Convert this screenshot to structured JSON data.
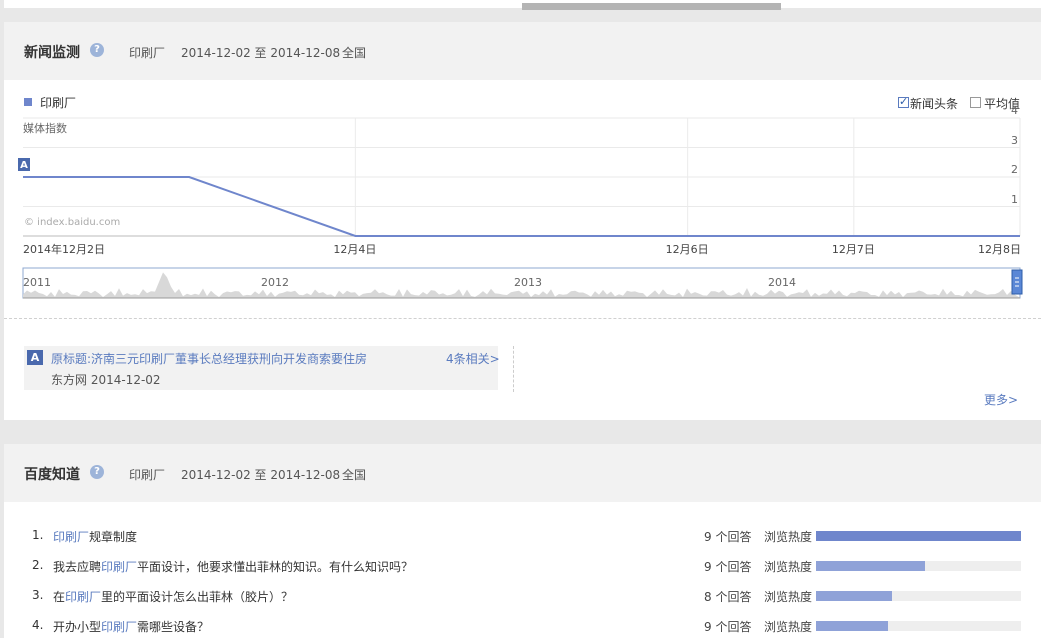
{
  "news_panel": {
    "title": "新闻监测",
    "keyword": "印刷厂",
    "date_range": "2014-12-02 至 2014-12-08",
    "region": "全国",
    "legend_label": "印刷厂",
    "checkbox_headlines": "新闻头条",
    "checkbox_headlines_checked": true,
    "checkbox_average": "平均值",
    "checkbox_average_checked": false,
    "watermark": "© index.baidu.com",
    "marker_label": "A",
    "overview_years": [
      "2011",
      "2012",
      "2013",
      "2014"
    ],
    "news_item": {
      "marker": "A",
      "title": "原标题:济南三元印刷厂董事长总经理获刑向开发商索要住房",
      "source": "东方网 2014-12-02",
      "related": "4条相关>"
    },
    "more_link": "更多>"
  },
  "chart_data": {
    "type": "line",
    "ylabel": "媒体指数",
    "y_ticks": [
      "1",
      "2",
      "3",
      "4"
    ],
    "ylim": [
      0,
      4
    ],
    "x_tick_labels": [
      "2014年12月2日",
      "12月4日",
      "12月6日",
      "12月7日",
      "12月8日"
    ],
    "x_tick_dates": [
      "2014-12-02",
      "2014-12-04",
      "2014-12-06",
      "2014-12-07",
      "2014-12-08"
    ],
    "xlim": [
      "2014-12-02",
      "2014-12-08"
    ],
    "grid": true,
    "series": [
      {
        "name": "印刷厂",
        "color": "#6f86cc",
        "x": [
          "2014-12-02",
          "2014-12-03",
          "2014-12-04",
          "2014-12-05",
          "2014-12-06",
          "2014-12-07",
          "2014-12-08"
        ],
        "values": [
          2,
          2,
          0,
          0,
          0,
          0,
          0
        ]
      }
    ]
  },
  "zhidao_panel": {
    "title": "百度知道",
    "keyword": "印刷厂",
    "date_range": "2014-12-02 至 2014-12-08",
    "region": "全国",
    "heat_label": "浏览热度",
    "questions": [
      {
        "num": "1.",
        "before": "",
        "highlight": "印刷厂",
        "after": "规章制度",
        "answers": "9 个回答",
        "heat": 1.0,
        "color": "#6f86cc"
      },
      {
        "num": "2.",
        "before": "我去应聘",
        "highlight": "印刷厂",
        "after": "平面设计，他要求懂出菲林的知识。有什么知识吗？",
        "answers": "9 个回答",
        "heat": 0.53,
        "color": "#8fa2d8"
      },
      {
        "num": "3.",
        "before": "在",
        "highlight": "印刷厂",
        "after": "里的平面设计怎么出菲林（胶片）？",
        "answers": "8 个回答",
        "heat": 0.37,
        "color": "#8fa2d8"
      },
      {
        "num": "4.",
        "before": "开办小型",
        "highlight": "印刷厂",
        "after": "需哪些设备？",
        "answers": "9 个回答",
        "heat": 0.35,
        "color": "#8fa2d8"
      }
    ]
  }
}
